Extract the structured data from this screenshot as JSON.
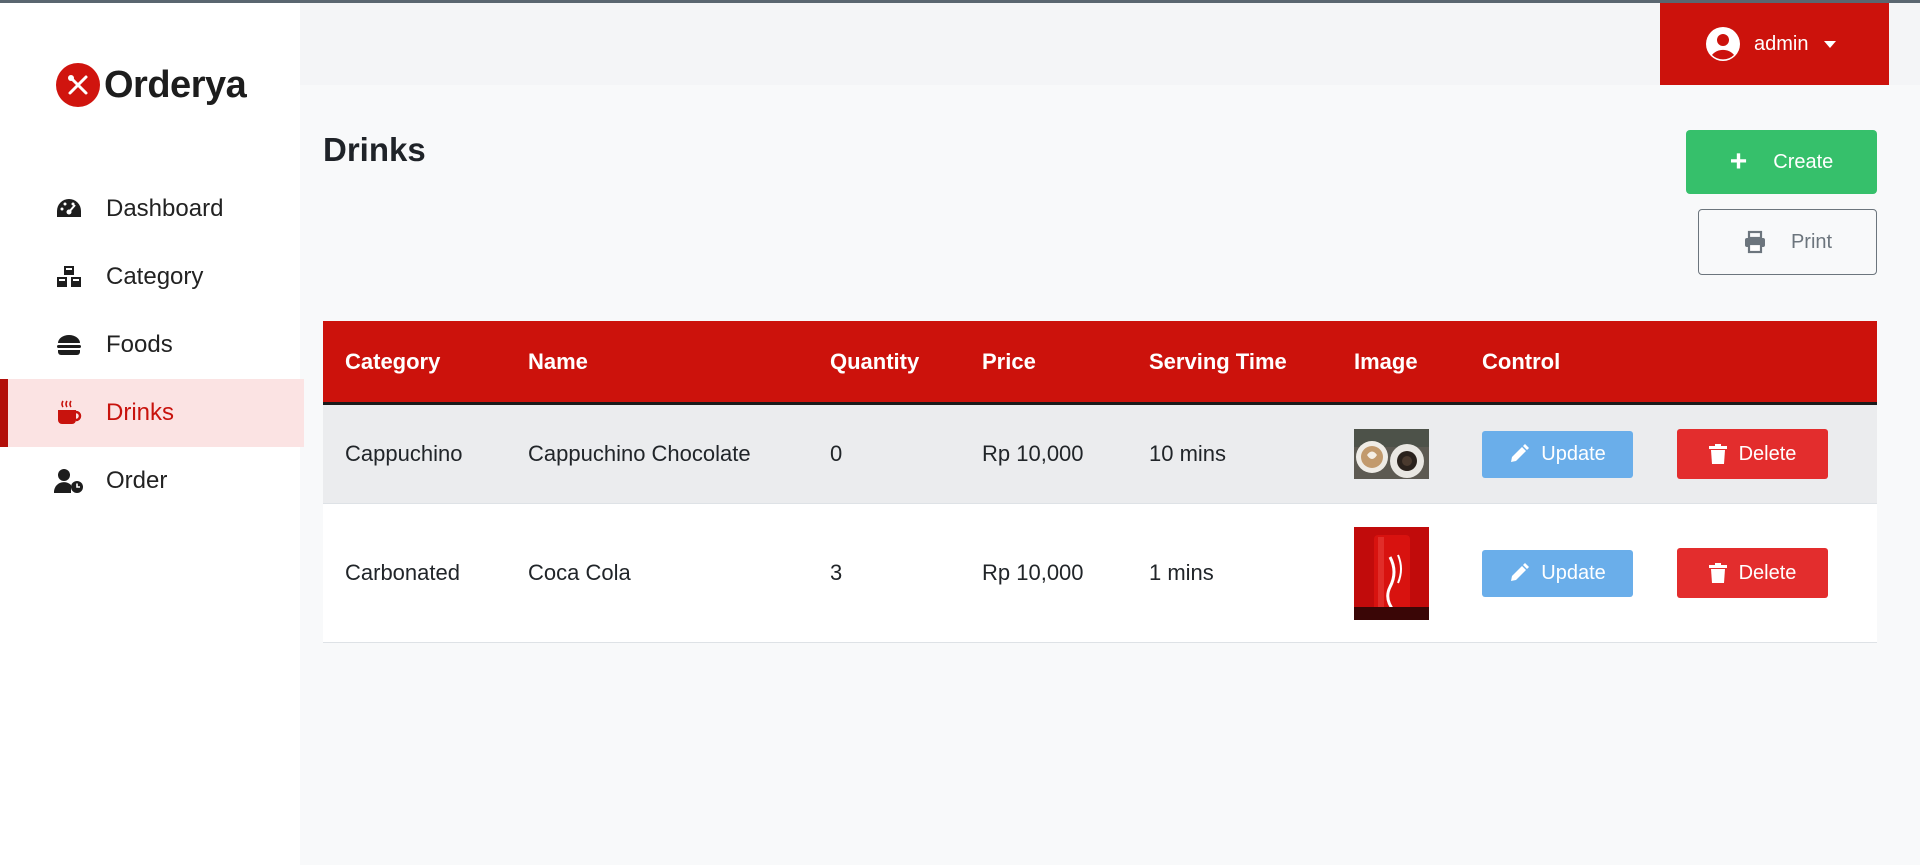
{
  "app": {
    "logo_text": "Orderya"
  },
  "sidebar": {
    "items": [
      {
        "label": "Dashboard",
        "icon": "gauge-icon"
      },
      {
        "label": "Category",
        "icon": "cubes-icon"
      },
      {
        "label": "Foods",
        "icon": "burger-icon"
      },
      {
        "label": "Drinks",
        "icon": "mug-hot-icon",
        "active": true
      },
      {
        "label": "Order",
        "icon": "user-clock-icon"
      }
    ]
  },
  "header": {
    "user_name": "admin"
  },
  "main": {
    "title": "Drinks",
    "create_label": "Create",
    "print_label": "Print"
  },
  "table": {
    "headers": [
      "Category",
      "Name",
      "Quantity",
      "Price",
      "Serving Time",
      "Image",
      "Control"
    ],
    "rows": [
      {
        "category": "Cappuchino",
        "name": "Cappuchino Chocolate",
        "quantity": "0",
        "price": "Rp 10,000",
        "serving_time": "10 mins",
        "image": "coffee-cups-photo",
        "update_label": "Update",
        "delete_label": "Delete"
      },
      {
        "category": "Carbonated",
        "name": "Coca Cola",
        "quantity": "3",
        "price": "Rp 10,000",
        "serving_time": "1 mins",
        "image": "coca-cola-can-photo",
        "update_label": "Update",
        "delete_label": "Delete"
      }
    ]
  },
  "colors": {
    "brand_red": "#cc120c",
    "create_green": "#36c06b",
    "update_blue": "#6aaeea",
    "delete_red": "#e32d2d",
    "active_bg": "#fbe3e3"
  }
}
